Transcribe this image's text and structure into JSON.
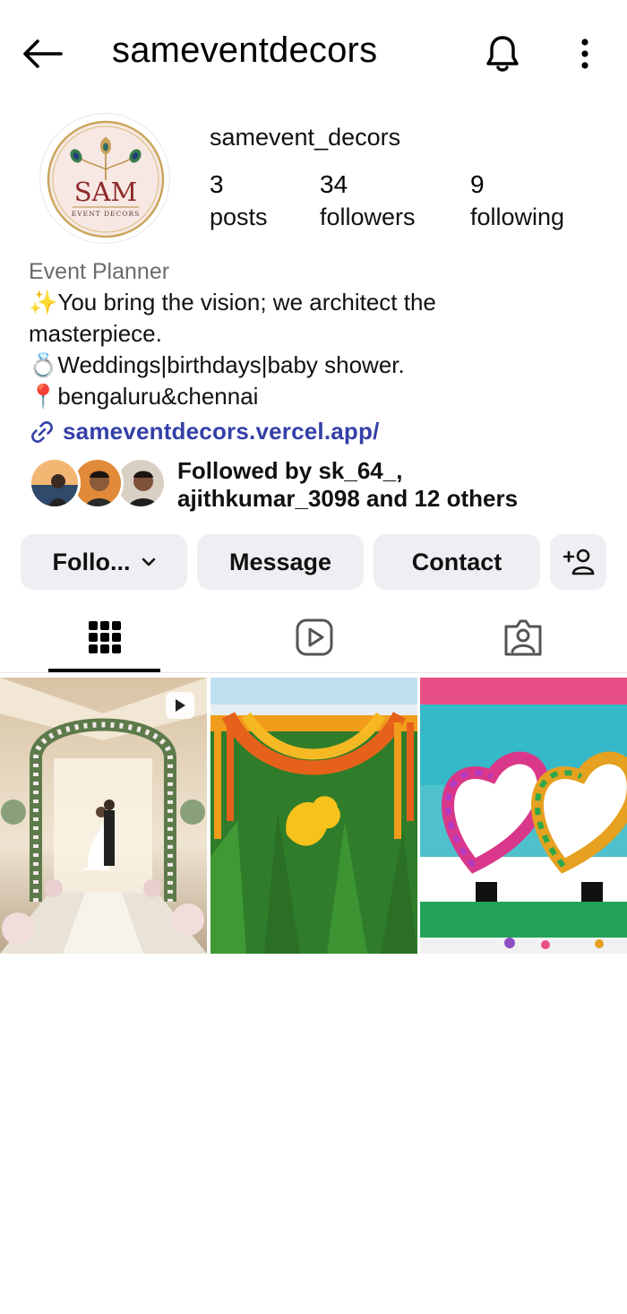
{
  "header": {
    "title": "sameventdecors",
    "back_icon": "arrow-left-icon",
    "bell_icon": "bell-icon",
    "more_icon": "more-vertical-icon"
  },
  "profile": {
    "avatar_logo": {
      "line1": "SAM",
      "line2": "EVENT DECORS"
    },
    "username": "samevent_decors",
    "stats": [
      {
        "num": "3",
        "label": "posts"
      },
      {
        "num": "34",
        "label": "followers"
      },
      {
        "num": "9",
        "label": "following"
      }
    ]
  },
  "bio": {
    "category": "Event Planner",
    "lines": [
      "✨You bring the vision; we architect the",
      "masterpiece.",
      "💍Weddings|birthdays|baby shower.",
      "📍bengaluru&chennai"
    ],
    "link": "sameventdecors.vercel.app/"
  },
  "followed_by": {
    "line1": "Followed by sk_64_,",
    "line2": "ajithkumar_3098 and 12 others"
  },
  "actions": {
    "follow": "Follo...",
    "message": "Message",
    "contact": "Contact",
    "add_icon": "add-person-icon"
  },
  "tabs": [
    {
      "icon": "grid-icon",
      "active": true
    },
    {
      "icon": "reels-icon",
      "active": false
    },
    {
      "icon": "tagged-icon",
      "active": false
    }
  ],
  "posts": [
    {
      "subject": "wedding floral arch",
      "is_reel": true
    },
    {
      "subject": "marigold banana leaf backdrop",
      "is_reel": false
    },
    {
      "subject": "floral heart stage decor",
      "is_reel": false
    }
  ],
  "colors": {
    "link": "#3440a8",
    "button_bg": "#efeff3",
    "muted_text": "#6b6b6b"
  }
}
